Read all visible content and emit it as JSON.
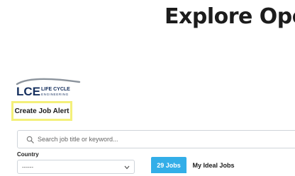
{
  "hero": {
    "title": "Explore Open"
  },
  "logo": {
    "mark": "LCE",
    "line1": "LIFE CYCLE",
    "line2": "ENGINEERING",
    "colors": {
      "navy": "#16305f",
      "swoosh": "#8c949d"
    }
  },
  "actions": {
    "create_alert_label": "Create Job Alert"
  },
  "search": {
    "placeholder": "Search job title or keyword...",
    "value": ""
  },
  "filters": {
    "country_label": "Country",
    "country_value": "------"
  },
  "tabs": [
    {
      "label": "29 Jobs",
      "active": true
    },
    {
      "label": "My Ideal Jobs",
      "active": false
    }
  ],
  "colors": {
    "accent": "#33aee8",
    "highlight": "#f4f07a",
    "border": "#cfd4da"
  },
  "icons": {
    "search": "search-icon",
    "dropdown": "chevron-down-icon"
  }
}
